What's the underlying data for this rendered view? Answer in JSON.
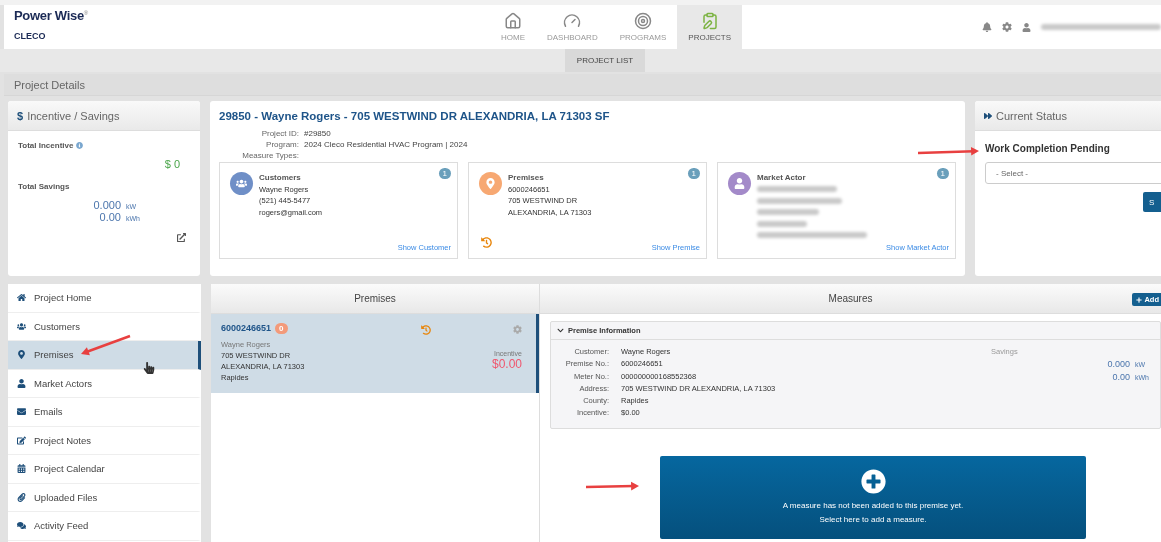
{
  "brand": {
    "name": "Power Wise",
    "mark": "®",
    "utility": "CLECO"
  },
  "nav": [
    {
      "label": "HOME",
      "selected": false
    },
    {
      "label": "DASHBOARD",
      "selected": false
    },
    {
      "label": "PROGRAMS",
      "selected": false
    },
    {
      "label": "PROJECTS",
      "selected": true
    }
  ],
  "subnav": [
    {
      "label": "PROJECT LIST",
      "selected": true
    }
  ],
  "page_title": "Project Details",
  "incentive_panel": {
    "title": "Incentive / Savings",
    "currency_icon": "$",
    "total_incentive_label": "Total Incentive",
    "total_incentive": "$ 0",
    "total_savings_label": "Total Savings",
    "savings": [
      {
        "value": "0.000",
        "unit": "kW"
      },
      {
        "value": "0.00",
        "unit": "kWh"
      }
    ]
  },
  "project": {
    "title": "29850 - Wayne Rogers - 705 WESTWIND DR ALEXANDRIA, LA 71303 SF",
    "fields": [
      {
        "label": "Project ID:",
        "value": "#29850"
      },
      {
        "label": "Program:",
        "value": "2024 Cleco Residential HVAC Program | 2024"
      },
      {
        "label": "Measure Types:"
      }
    ],
    "cards": [
      {
        "kind": "customer",
        "title": "Customers",
        "count": "1",
        "lines": [
          "Wayne Rogers",
          "(521) 445-5477",
          "rogers@gmail.com"
        ],
        "link": "Show Customer",
        "history": false
      },
      {
        "kind": "premise",
        "title": "Premises",
        "count": "1",
        "lines": [
          "6000246651",
          "705 WESTWIND DR",
          "ALEXANDRIA, LA 71303"
        ],
        "link": "Show Premise",
        "history": true
      },
      {
        "kind": "actor",
        "title": "Market Actor",
        "count": "1",
        "link": "Show Market Actor",
        "history": false
      }
    ]
  },
  "status_panel": {
    "title": "Current Status",
    "status": "Work Completion Pending",
    "select": {
      "placeholder": "- Select -"
    },
    "button": "S"
  },
  "sidebar": {
    "items": [
      {
        "label": "Project Home",
        "selected": false
      },
      {
        "label": "Customers",
        "selected": false
      },
      {
        "label": "Premises",
        "selected": true
      },
      {
        "label": "Market Actors",
        "selected": false
      },
      {
        "label": "Emails",
        "selected": false
      },
      {
        "label": "Project Notes",
        "selected": false
      },
      {
        "label": "Project Calendar",
        "selected": false
      },
      {
        "label": "Uploaded Files",
        "selected": false
      },
      {
        "label": "Activity Feed",
        "selected": false
      }
    ]
  },
  "premises_panel": {
    "title": "Premises",
    "items": [
      {
        "number": "6000246651",
        "badge": "0",
        "name": "Wayne Rogers",
        "address_lines": [
          "705 WESTWIND DR",
          "ALEXANDRIA, LA 71303"
        ],
        "county": "Rapides",
        "incentive_label": "Incentive",
        "incentive": "$0.00",
        "selected": true
      }
    ]
  },
  "measures_panel": {
    "title": "Measures",
    "add_button": "Add",
    "premise_info": {
      "title": "Premise Information",
      "expanded": true,
      "fields": [
        {
          "label": "Customer:",
          "value": "Wayne Rogers"
        },
        {
          "label": "Premise No.:",
          "value": "6000246651"
        },
        {
          "label": "Meter No.:",
          "value": "000000000168552368"
        },
        {
          "label": "Address:",
          "value": "705 WESTWIND DR ALEXANDRIA, LA 71303"
        },
        {
          "label": "County:",
          "value": "Rapides"
        },
        {
          "label": "Incentive:",
          "value": "$0.00"
        }
      ],
      "savings_label": "Savings",
      "savings": [
        {
          "value": "0.000",
          "unit": "kW"
        },
        {
          "value": "0.00",
          "unit": "kWh"
        }
      ]
    },
    "empty_prompt": [
      "A measure has not been added to this premise yet.",
      "Select here to add a measure."
    ]
  }
}
